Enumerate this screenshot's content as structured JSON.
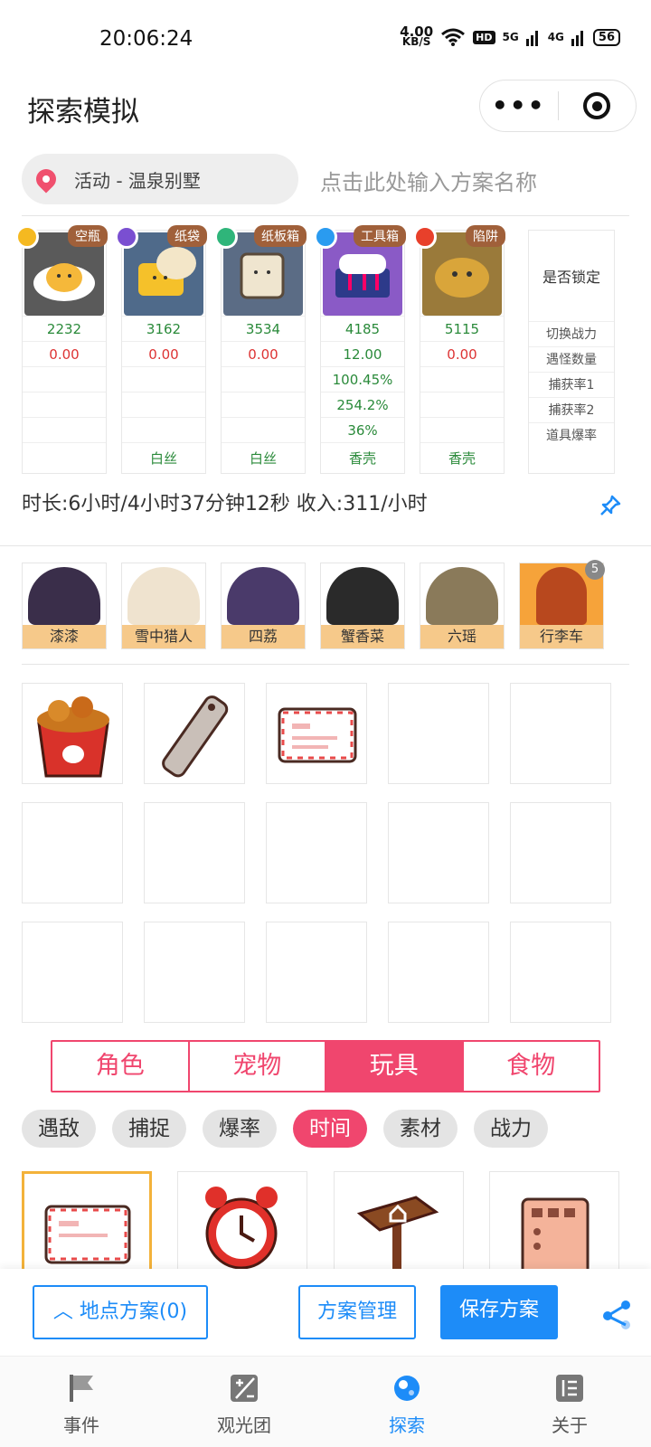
{
  "status": {
    "time": "20:06:24",
    "speed": "4.00",
    "speed_unit": "KB/S",
    "hd": "HD",
    "sig1": "5G",
    "sig2": "4G",
    "battery": "56"
  },
  "header": {
    "title": "探索模拟"
  },
  "location": {
    "label": "活动 - 温泉别墅",
    "plan_placeholder": "点击此处输入方案名称"
  },
  "team": [
    {
      "tag": "空瓶",
      "power": "2232",
      "switch": "0.00",
      "r3": "",
      "r4": "",
      "r5": "",
      "item": ""
    },
    {
      "tag": "纸袋",
      "power": "3162",
      "switch": "0.00",
      "r3": "",
      "r4": "",
      "r5": "",
      "item": "白丝"
    },
    {
      "tag": "纸板箱",
      "power": "3534",
      "switch": "0.00",
      "r3": "",
      "r4": "",
      "r5": "",
      "item": "白丝"
    },
    {
      "tag": "工具箱",
      "power": "4185",
      "switch": "12.00",
      "r3": "100.45%",
      "r4": "254.2%",
      "r5": "36%",
      "item": "香壳"
    },
    {
      "tag": "陷阱",
      "power": "5115",
      "switch": "0.00",
      "r3": "",
      "r4": "",
      "r5": "",
      "item": "香壳"
    }
  ],
  "lock_col": {
    "head": "是否锁定",
    "rows": [
      "切换战力",
      "遇怪数量",
      "捕获率1",
      "捕获率2",
      "道具爆率"
    ]
  },
  "duration": {
    "text": "时长:6小时/4小时37分钟12秒 收入:311/小时"
  },
  "roles": [
    {
      "name": "漆漆"
    },
    {
      "name": "雪中猎人"
    },
    {
      "name": "四荔"
    },
    {
      "name": "蟹香菜"
    },
    {
      "name": "六瑶"
    },
    {
      "name": "行李车",
      "count": "5"
    }
  ],
  "category_tabs": [
    "角色",
    "宠物",
    "玩具",
    "食物"
  ],
  "filter_chips": [
    "遇敌",
    "捕捉",
    "爆率",
    "时间",
    "素材",
    "战力"
  ],
  "bottom": {
    "location_plan": "地点方案(0)",
    "manage": "方案管理",
    "save": "保存方案"
  },
  "tabbar": [
    "事件",
    "观光团",
    "探索",
    "关于"
  ],
  "colors": {
    "accent": "#f0466e",
    "primary": "#1d8cf8",
    "green": "#2a8a3a",
    "red": "#dd3333"
  }
}
